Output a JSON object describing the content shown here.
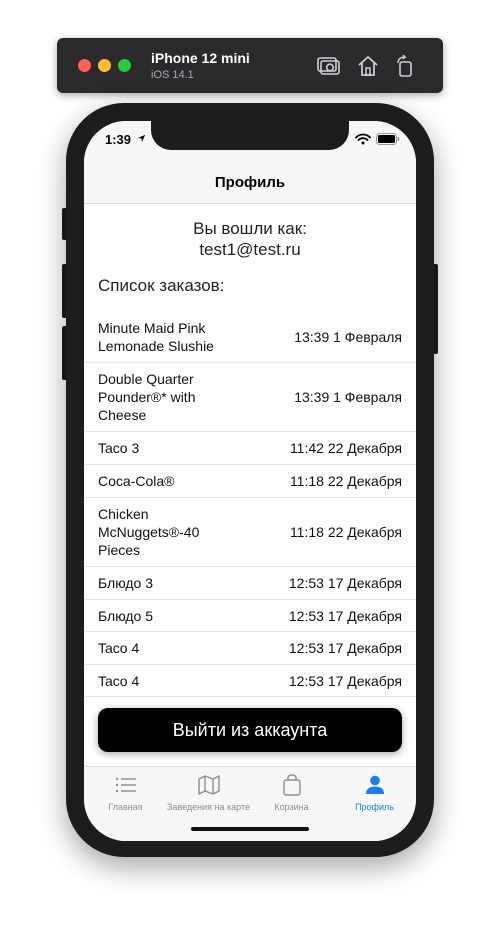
{
  "simulator": {
    "device_name": "iPhone 12 mini",
    "os_version": "iOS 14.1"
  },
  "status_bar": {
    "time": "1:39"
  },
  "nav": {
    "title": "Профиль"
  },
  "profile": {
    "logged_in_label": "Вы вошли как:",
    "email": "test1@test.ru",
    "orders_title": "Список заказов:"
  },
  "orders": [
    {
      "name": "Minute Maid Pink Lemonade Slushie",
      "date": "13:39 1 Февраля"
    },
    {
      "name": "Double Quarter Pounder®* with Cheese",
      "date": "13:39 1 Февраля"
    },
    {
      "name": "Taco 3",
      "date": "11:42 22 Декабря"
    },
    {
      "name": "Coca-Cola®",
      "date": "11:18 22 Декабря"
    },
    {
      "name": "Chicken McNuggets®-40 Pieces",
      "date": "11:18 22 Декабря"
    },
    {
      "name": "Блюдо 3",
      "date": "12:53 17 Декабря"
    },
    {
      "name": "Блюдо 5",
      "date": "12:53 17 Декабря"
    },
    {
      "name": "Taco 4",
      "date": "12:53 17 Декабря"
    },
    {
      "name": "Taco 4",
      "date": "12:53 17 Декабря"
    }
  ],
  "logout_button": {
    "label": "Выйти из аккаунта"
  },
  "tabs": [
    {
      "label": "Главная",
      "icon": "list-icon",
      "active": false
    },
    {
      "label": "Заведения на карте",
      "icon": "map-icon",
      "active": false
    },
    {
      "label": "Корзина",
      "icon": "bag-icon",
      "active": false
    },
    {
      "label": "Профиль",
      "icon": "person-icon",
      "active": true
    }
  ],
  "colors": {
    "accent": "#1a7ee8",
    "inactive_tab": "#8e8e93",
    "button_bg": "#000000"
  }
}
